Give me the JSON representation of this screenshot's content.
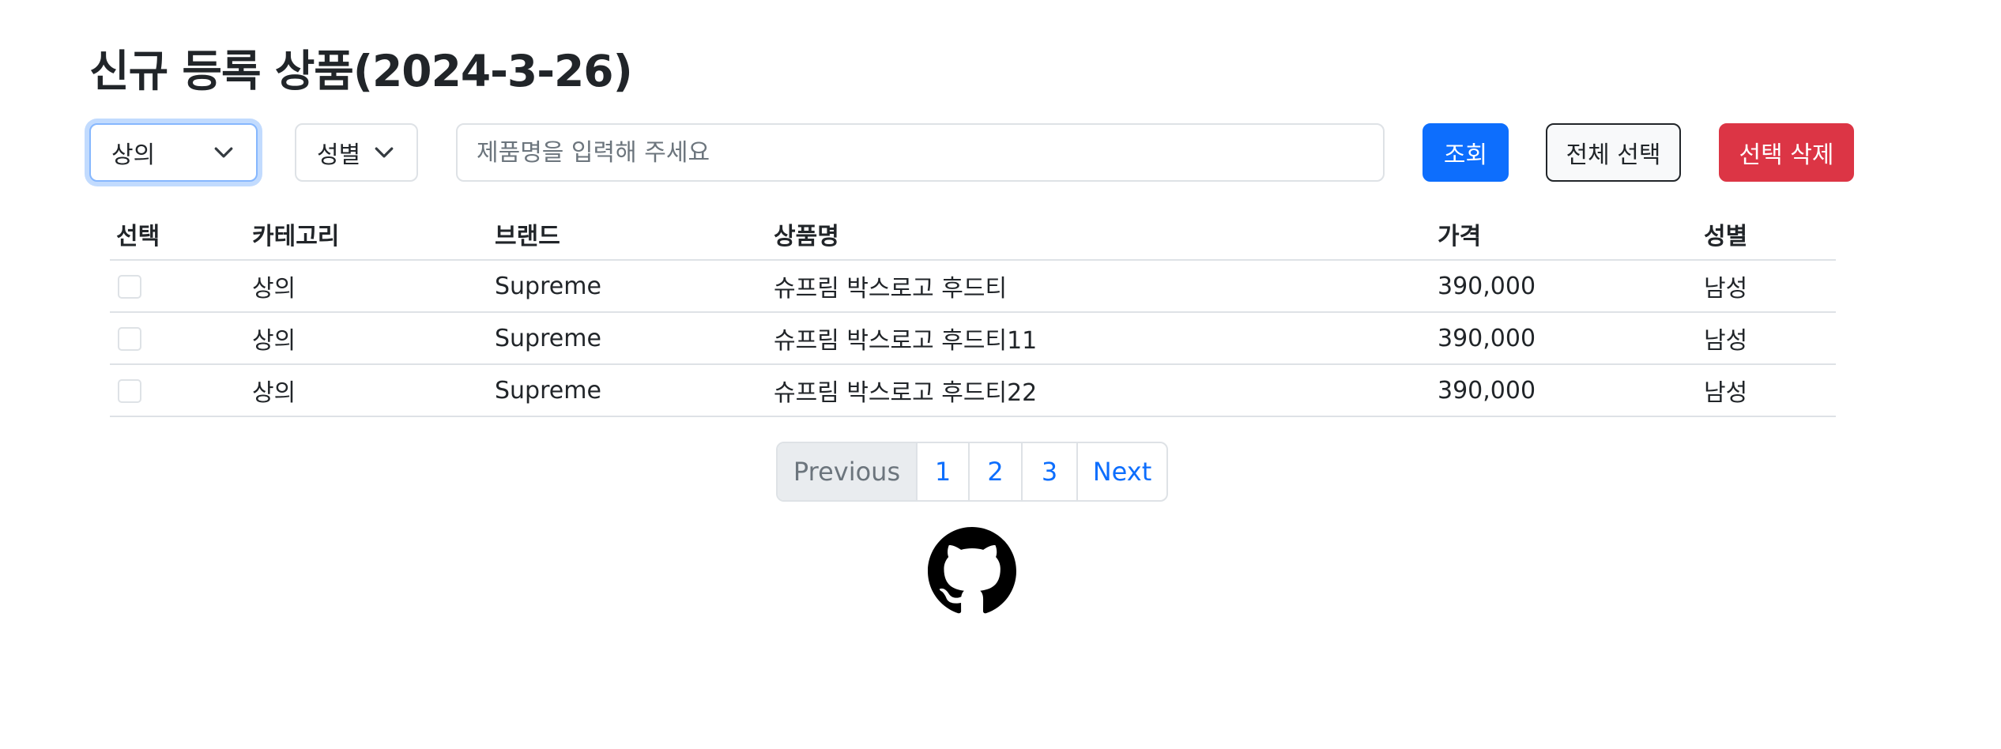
{
  "page": {
    "title": "신규 등록 상품(2024-3-26)"
  },
  "filters": {
    "category": {
      "selected": "상의"
    },
    "gender": {
      "selected": "성별"
    },
    "search": {
      "placeholder": "제품명을 입력해 주세요",
      "value": ""
    },
    "search_button": "조회",
    "select_all_button": "전체 선택",
    "delete_selected_button": "선택 삭제"
  },
  "table": {
    "headers": [
      "선택",
      "카테고리",
      "브랜드",
      "상품명",
      "가격",
      "성별"
    ],
    "rows": [
      {
        "checked": false,
        "category": "상의",
        "brand": "Supreme",
        "name": "슈프림 박스로고 후드티",
        "price": "390,000",
        "gender": "남성"
      },
      {
        "checked": false,
        "category": "상의",
        "brand": "Supreme",
        "name": "슈프림 박스로고 후드티11",
        "price": "390,000",
        "gender": "남성"
      },
      {
        "checked": false,
        "category": "상의",
        "brand": "Supreme",
        "name": "슈프림 박스로고 후드티22",
        "price": "390,000",
        "gender": "남성"
      }
    ]
  },
  "pagination": {
    "previous": "Previous",
    "pages": [
      "1",
      "2",
      "3"
    ],
    "next": "Next"
  },
  "footer": {
    "icon": "github-icon"
  },
  "colors": {
    "primary": "#0d6efd",
    "danger": "#dc3545",
    "border": "#dee2e6",
    "disabled_bg": "#e9ecef"
  }
}
